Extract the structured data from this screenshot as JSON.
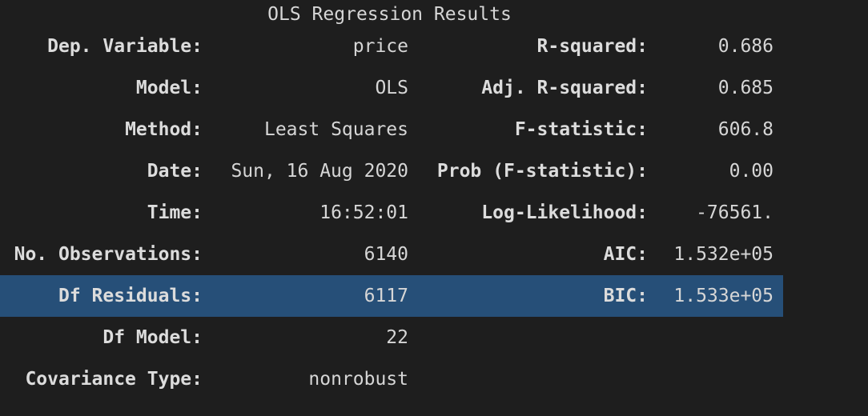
{
  "table": {
    "caption": "OLS Regression Results",
    "rows": [
      {
        "key1": "Dep. Variable:",
        "val1": "price",
        "key2": "R-squared:",
        "val2": "0.686"
      },
      {
        "key1": "Model:",
        "val1": "OLS",
        "key2": "Adj. R-squared:",
        "val2": "0.685"
      },
      {
        "key1": "Method:",
        "val1": "Least Squares",
        "key2": "F-statistic:",
        "val2": "606.8"
      },
      {
        "key1": "Date:",
        "val1": "Sun, 16 Aug 2020",
        "key2": "Prob (F-statistic):",
        "val2": "0.00"
      },
      {
        "key1": "Time:",
        "val1": "16:52:01",
        "key2": "Log-Likelihood:",
        "val2": "-76561."
      },
      {
        "key1": "No. Observations:",
        "val1": "6140",
        "key2": "AIC:",
        "val2": "1.532e+05"
      },
      {
        "key1": "Df Residuals:",
        "val1": "6117",
        "key2": "BIC:",
        "val2": "1.533e+05"
      },
      {
        "key1": "Df Model:",
        "val1": "22",
        "key2": "",
        "val2": ""
      },
      {
        "key1": "Covariance Type:",
        "val1": "nonrobust",
        "key2": "",
        "val2": ""
      }
    ],
    "selected_row": "Df Residuals:"
  },
  "colors": {
    "background": "#1e1e1e",
    "selection": "#264f78",
    "text": "#d6d6d6"
  }
}
